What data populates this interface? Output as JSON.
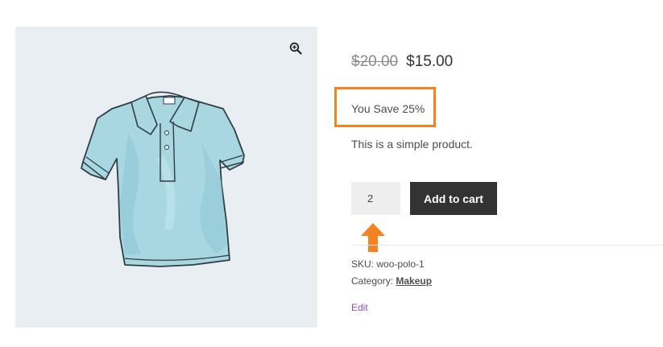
{
  "gallery": {
    "zoom_icon": "zoom-in-icon",
    "image_icon": "polo-shirt-image"
  },
  "price": {
    "regular": "$20.00",
    "sale": "$15.00"
  },
  "savings": {
    "text": "You Save 25%"
  },
  "short_description": "This is a simple product.",
  "cart": {
    "quantity": "2",
    "button_label": "Add to cart"
  },
  "meta": {
    "sku_label": "SKU:",
    "sku_value": "woo-polo-1",
    "category_label": "Category:",
    "category_value": "Makeup"
  },
  "edit_label": "Edit",
  "colors": {
    "highlight_orange": "#f58220",
    "button_dark": "#333333",
    "shirt_blue": "#9fd3de",
    "link_purple": "#8a4fba"
  }
}
